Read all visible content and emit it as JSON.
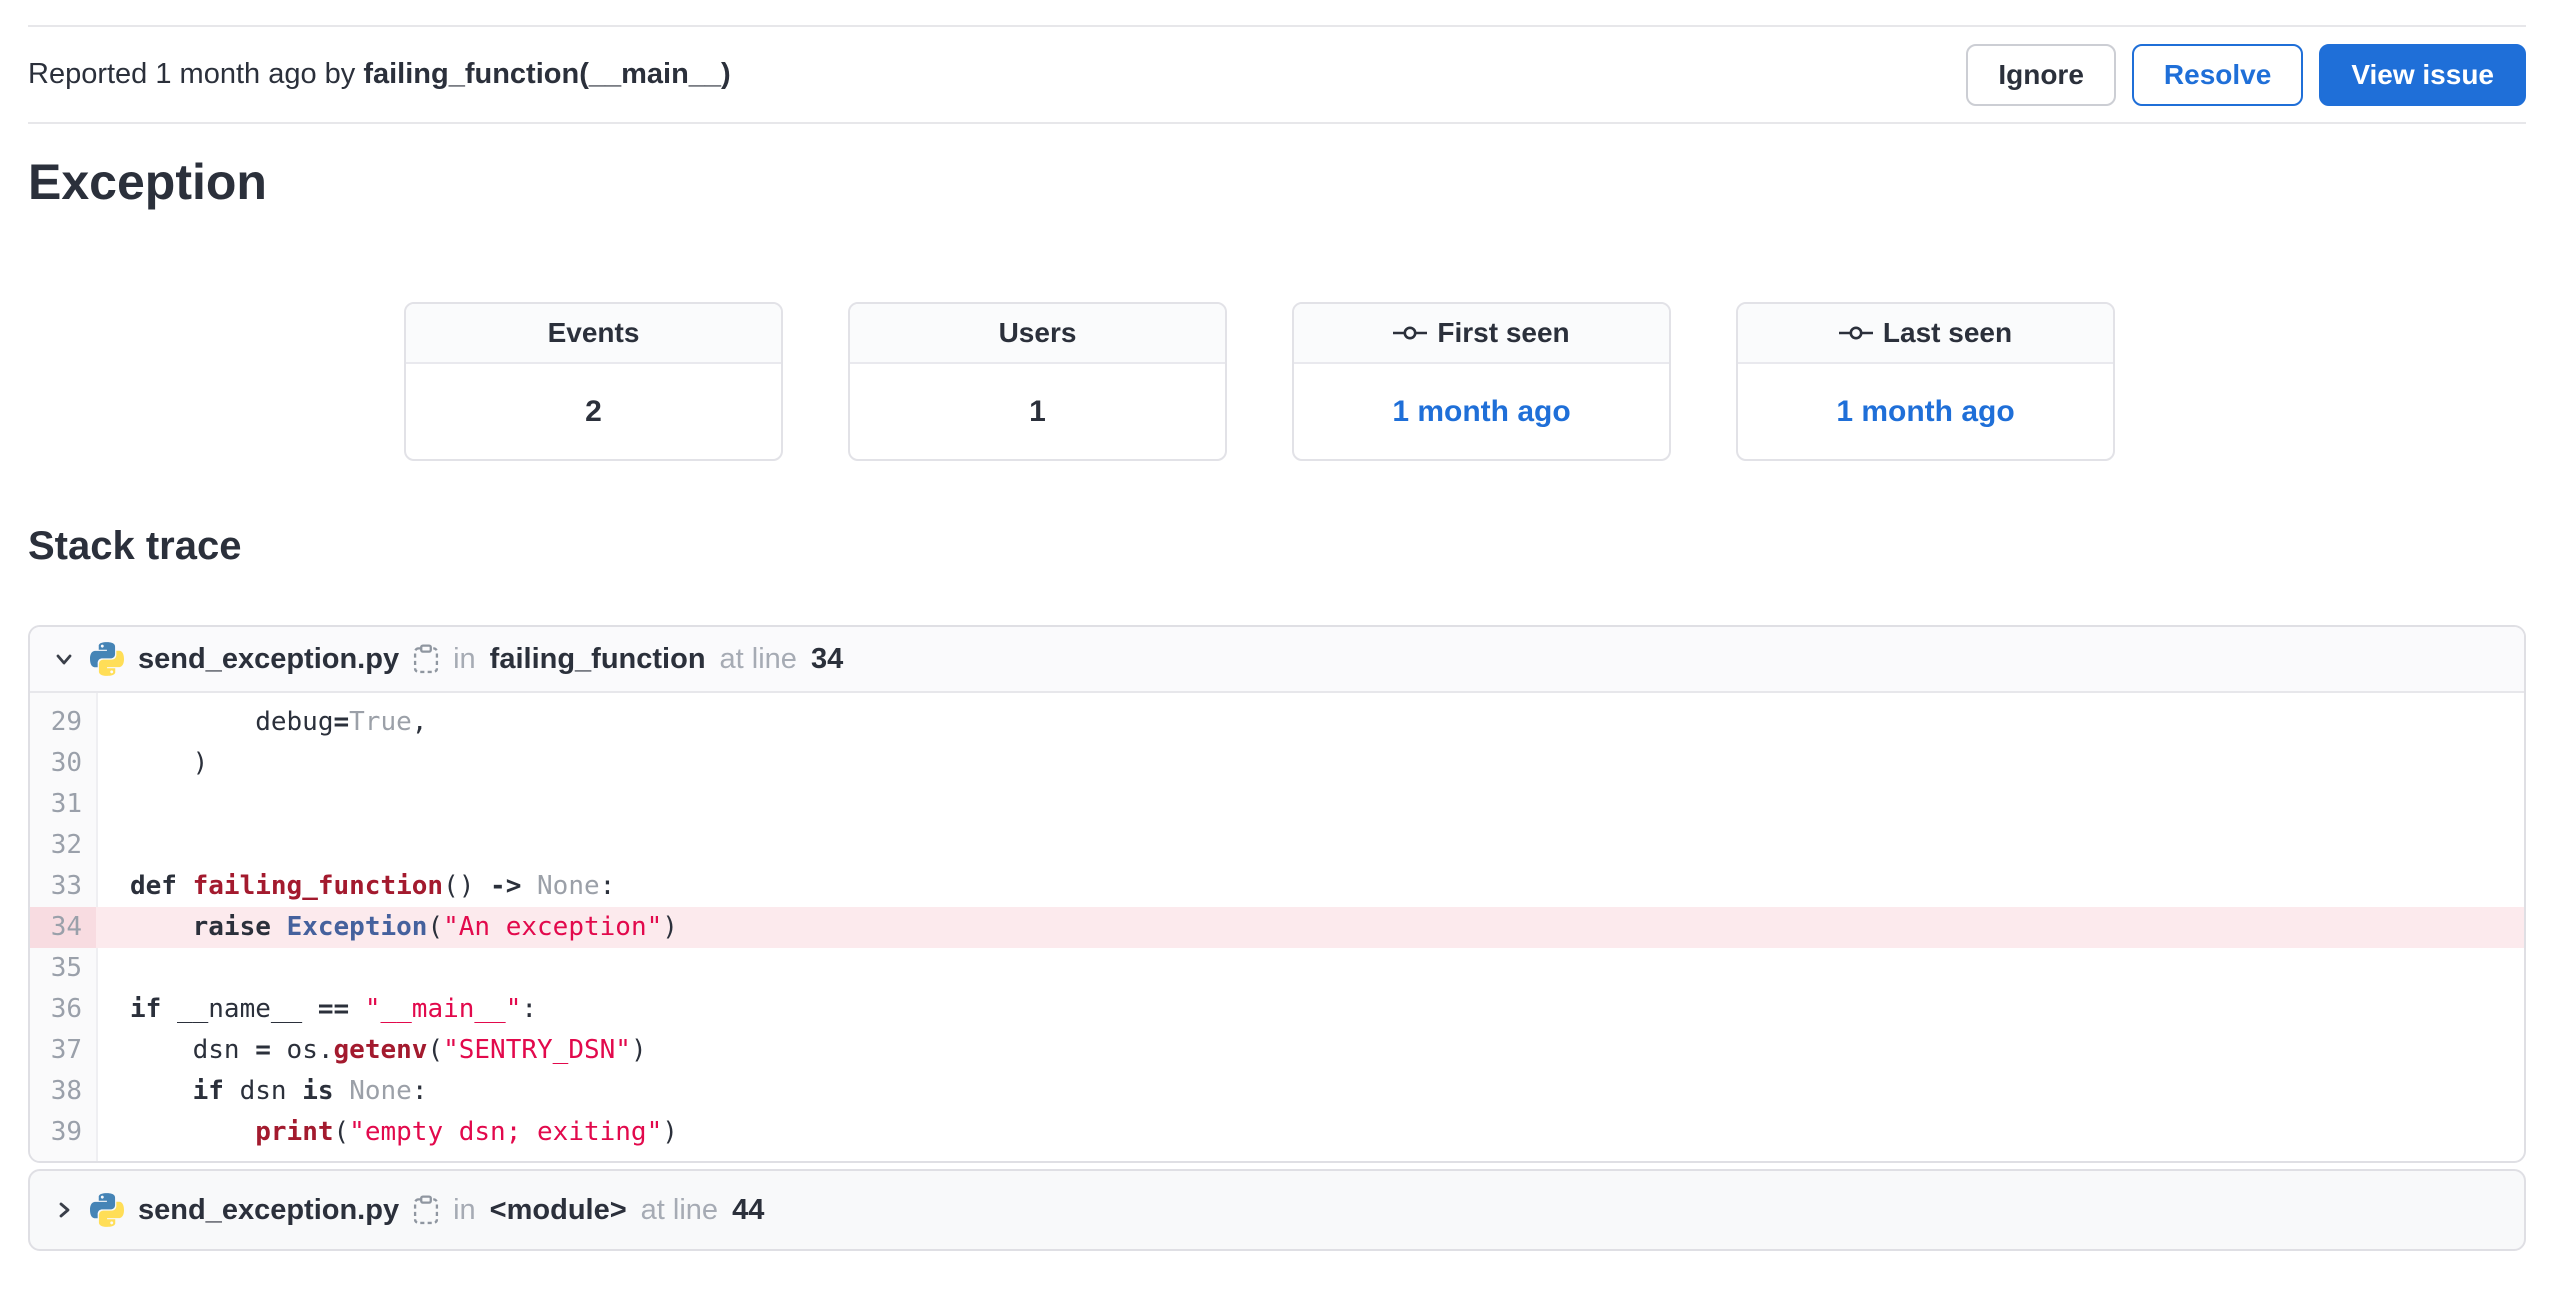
{
  "colors": {
    "accent_blue": "#1f6fd8",
    "ink": "#2b303b",
    "muted_gray": "#a6abb4",
    "string_red": "#e2094c",
    "function_red": "#a31a2e",
    "class_blue": "#45619d",
    "constant_gray": "#9ba0a8",
    "highlight_pink": "#fceaed"
  },
  "header": {
    "reported_prefix": "Reported 1 month ago by ",
    "reporter": "failing_function(__main__)",
    "buttons": [
      {
        "label": "Ignore",
        "variant": "default"
      },
      {
        "label": "Resolve",
        "variant": "outline-primary"
      },
      {
        "label": "View issue",
        "variant": "primary"
      }
    ]
  },
  "exception_section": {
    "title": "Exception",
    "stats": [
      {
        "label": "Events",
        "value": "2"
      },
      {
        "label": "Users",
        "value": "1"
      },
      {
        "label": "First seen",
        "value": "1 month ago",
        "icon": "commit-icon",
        "value_is_link": true
      },
      {
        "label": "Last seen",
        "value": "1 month ago",
        "icon": "commit-icon",
        "value_is_link": true
      }
    ]
  },
  "stack_trace": {
    "title": "Stack trace",
    "frames": [
      {
        "file": "send_exception.py",
        "in_label": "in",
        "function": "failing_function",
        "at_label": "at line",
        "line_number": "34",
        "expanded": true,
        "icons": [
          "chevron-down-icon",
          "python-icon",
          "copy-icon"
        ],
        "code": {
          "highlight_line": 34,
          "lines": [
            {
              "no": 29,
              "tokens": [
                [
                  "p",
                  "        debug"
                ],
                [
                  "o",
                  "="
                ],
                [
                  "n",
                  "True"
                ],
                [
                  "p",
                  ","
                ]
              ]
            },
            {
              "no": 30,
              "tokens": [
                [
                  "p",
                  "    )"
                ]
              ]
            },
            {
              "no": 31,
              "tokens": []
            },
            {
              "no": 32,
              "tokens": []
            },
            {
              "no": 33,
              "tokens": [
                [
                  "k",
                  "def"
                ],
                [
                  "p",
                  " "
                ],
                [
                  "f",
                  "failing_function"
                ],
                [
                  "p",
                  "() "
                ],
                [
                  "o",
                  "->"
                ],
                [
                  "p",
                  " "
                ],
                [
                  "n",
                  "None"
                ],
                [
                  "p",
                  ":"
                ]
              ]
            },
            {
              "no": 34,
              "tokens": [
                [
                  "p",
                  "    "
                ],
                [
                  "k",
                  "raise"
                ],
                [
                  "p",
                  " "
                ],
                [
                  "c",
                  "Exception"
                ],
                [
                  "p",
                  "("
                ],
                [
                  "s",
                  "\"An exception\""
                ],
                [
                  "p",
                  ")"
                ]
              ]
            },
            {
              "no": 35,
              "tokens": []
            },
            {
              "no": 36,
              "tokens": [
                [
                  "k",
                  "if"
                ],
                [
                  "p",
                  " __name__ "
                ],
                [
                  "o",
                  "=="
                ],
                [
                  "p",
                  " "
                ],
                [
                  "s",
                  "\"__main__\""
                ],
                [
                  "p",
                  ":"
                ]
              ]
            },
            {
              "no": 37,
              "tokens": [
                [
                  "p",
                  "    dsn "
                ],
                [
                  "o",
                  "="
                ],
                [
                  "p",
                  " os."
                ],
                [
                  "f",
                  "getenv"
                ],
                [
                  "p",
                  "("
                ],
                [
                  "s",
                  "\"SENTRY_DSN\""
                ],
                [
                  "p",
                  ")"
                ]
              ]
            },
            {
              "no": 38,
              "tokens": [
                [
                  "p",
                  "    "
                ],
                [
                  "k",
                  "if"
                ],
                [
                  "p",
                  " dsn "
                ],
                [
                  "k",
                  "is"
                ],
                [
                  "p",
                  " "
                ],
                [
                  "n",
                  "None"
                ],
                [
                  "p",
                  ":"
                ]
              ]
            },
            {
              "no": 39,
              "tokens": [
                [
                  "p",
                  "        "
                ],
                [
                  "f",
                  "print"
                ],
                [
                  "p",
                  "("
                ],
                [
                  "s",
                  "\"empty dsn; exiting\""
                ],
                [
                  "p",
                  ")"
                ]
              ]
            }
          ]
        }
      },
      {
        "file": "send_exception.py",
        "in_label": "in",
        "function": "<module>",
        "at_label": "at line",
        "line_number": "44",
        "expanded": false,
        "icons": [
          "chevron-right-icon",
          "python-icon",
          "copy-icon"
        ]
      }
    ]
  }
}
